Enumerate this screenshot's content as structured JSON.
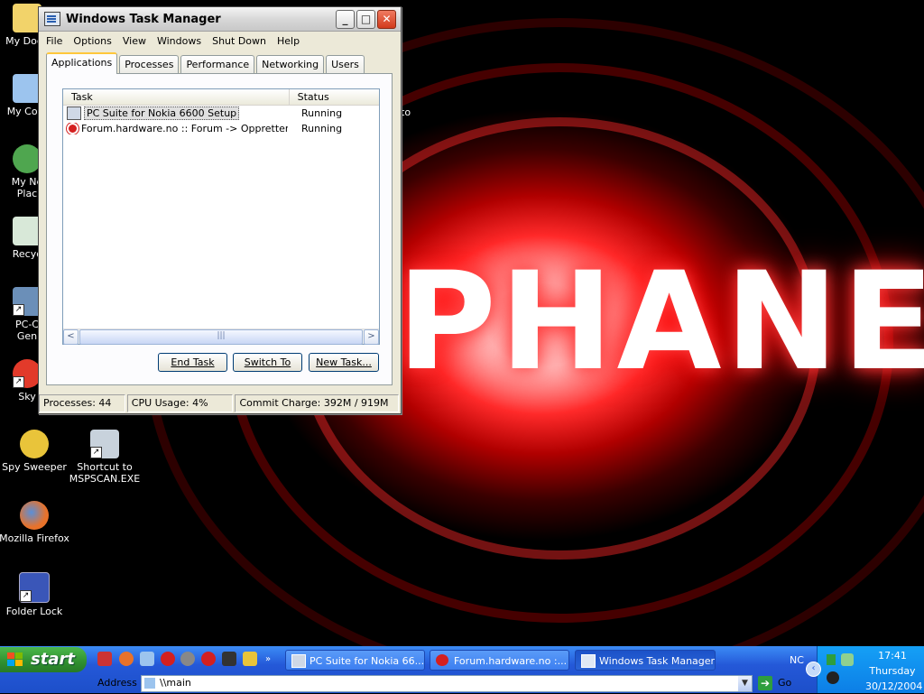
{
  "desktop": {
    "wallpaper_text": "PHANE",
    "icons": [
      {
        "label": "My Docu"
      },
      {
        "label": "My Com"
      },
      {
        "label": "My Ne",
        "label2": "Plac"
      },
      {
        "label": "Recyc"
      },
      {
        "label": "PC-C",
        "label2": "Gen"
      },
      {
        "label": "Sky"
      },
      {
        "label": "Spy Sweeper"
      },
      {
        "label": "Shortcut to",
        "label2": "MSPSCAN.EXE"
      },
      {
        "label": "Mozilla Firefox"
      },
      {
        "label": "Folder Lock"
      }
    ],
    "partial_right_text": "to"
  },
  "window": {
    "title": "Windows Task Manager",
    "minimize_label": "_",
    "maximize_label": "□",
    "close_label": "✕",
    "menu": [
      "File",
      "Options",
      "View",
      "Windows",
      "Shut Down",
      "Help"
    ],
    "tabs": [
      "Applications",
      "Processes",
      "Performance",
      "Networking",
      "Users"
    ],
    "active_tab": "Applications",
    "columns": {
      "task": "Task",
      "status": "Status"
    },
    "rows": [
      {
        "task": "PC Suite for Nokia 6600 Setup",
        "status": "Running",
        "icon": "setup-window-icon",
        "selected": true
      },
      {
        "task": "Forum.hardware.no :: Forum -> Oppretter n...",
        "status": "Running",
        "icon": "opera-icon",
        "selected": false
      }
    ],
    "scroll_left": "<",
    "scroll_right": ">",
    "scroll_grip": "|||",
    "buttons": {
      "end_task": "End Task",
      "switch_to": "Switch To",
      "new_task": "New Task..."
    },
    "status": {
      "processes": "Processes: 44",
      "cpu": "CPU Usage: 4%",
      "commit": "Commit Charge: 392M / 919M"
    }
  },
  "taskbar": {
    "start_label": "start",
    "buttons": [
      {
        "label": "PC Suite for Nokia 66...",
        "active": false
      },
      {
        "label": "Forum.hardware.no :...",
        "active": false
      },
      {
        "label": "Windows Task Manager",
        "active": true
      }
    ],
    "nc_label": "NC",
    "address_label": "Address",
    "address_value": "\\\\main",
    "go_label": "Go",
    "clock": {
      "time": "17:41",
      "day": "Thursday",
      "date": "30/12/2004"
    },
    "colors": {
      "taskbar_blue": "#2458d8",
      "start_green": "#2f8f2f",
      "tray_blue": "#0c7ee6"
    }
  }
}
